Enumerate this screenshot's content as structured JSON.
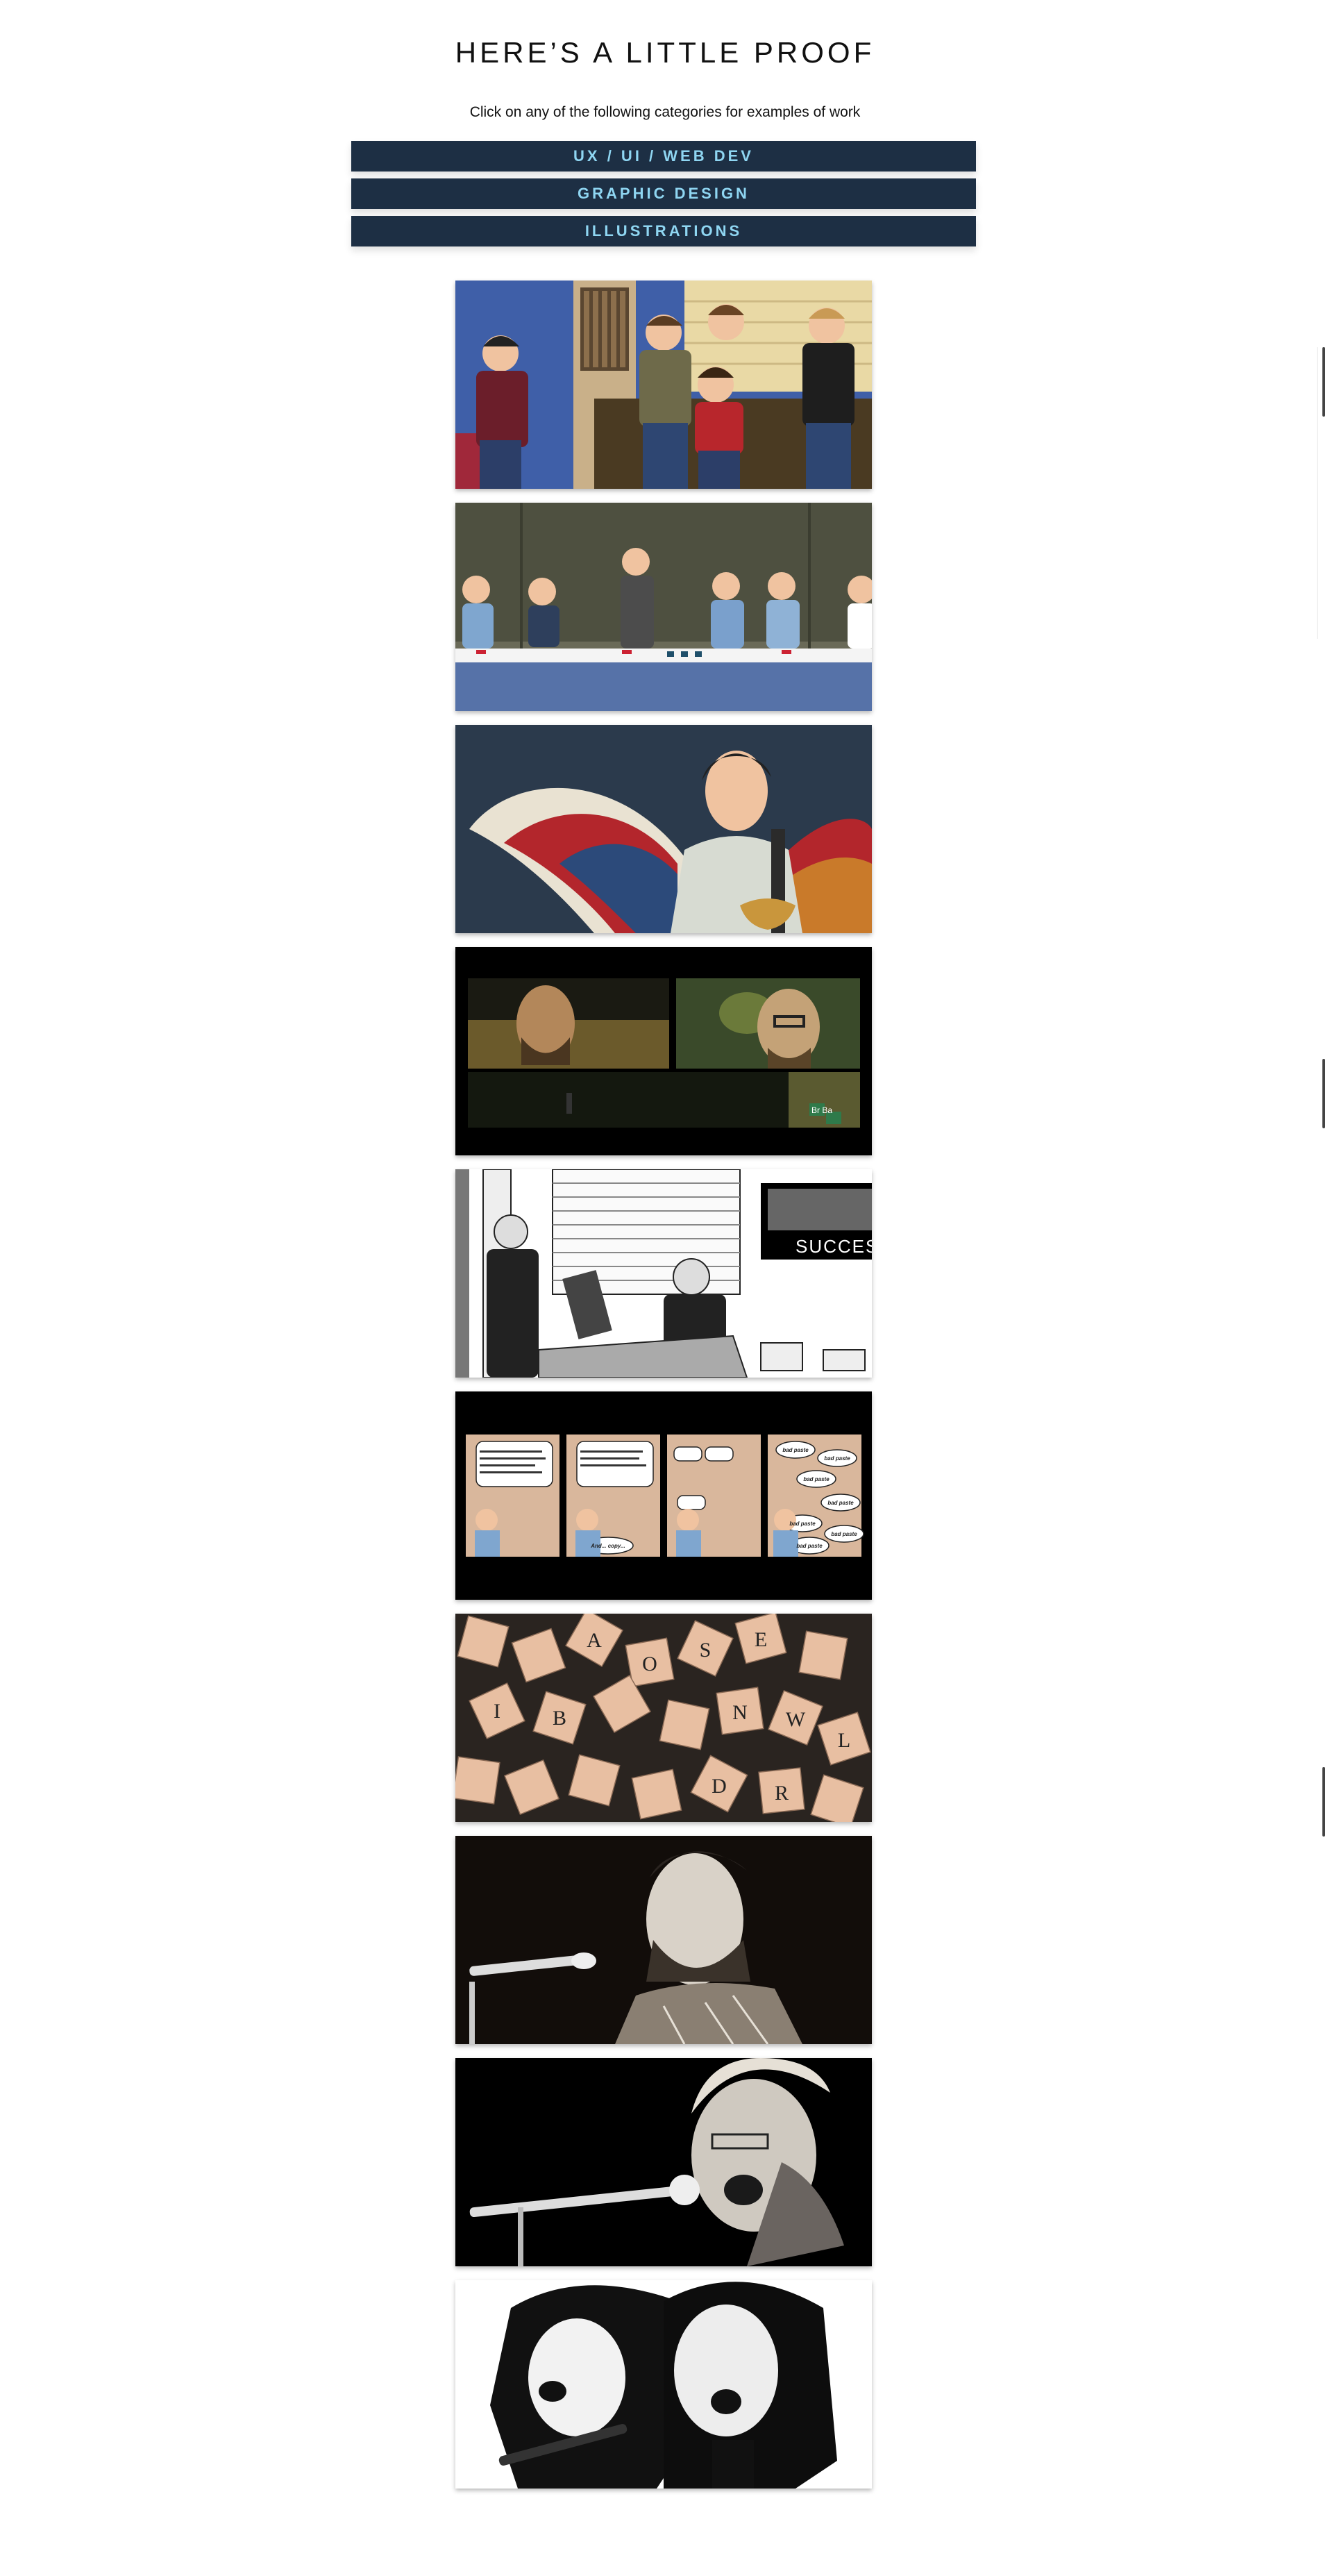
{
  "proof": {
    "heading": "HERE’S A LITTLE PROOF",
    "subheading": "Click on any of the following categories for examples of work",
    "categories": [
      {
        "label": "UX / UI / WEB DEV"
      },
      {
        "label": "GRAPHIC DESIGN"
      },
      {
        "label": "ILLUSTRATIONS"
      }
    ]
  },
  "gallery": {
    "items": [
      {
        "theme": "cartoon-friends-couch"
      },
      {
        "theme": "cartoon-last-supper-table"
      },
      {
        "theme": "musician-with-wings"
      },
      {
        "theme": "dark-comic-panels",
        "sign_text": "Br Ba"
      },
      {
        "theme": "office-handshake-comic",
        "tv_text": "SUCCES"
      },
      {
        "theme": "four-panel-office-comic",
        "speech": [
          "And... copy...",
          "bad paste",
          "bad paste",
          "bad paste",
          "bad paste",
          "bad paste",
          "bad paste",
          "bad paste"
        ]
      },
      {
        "theme": "scrabble-tiles",
        "letters": [
          "O",
          "B",
          "I",
          "N",
          "W",
          "L",
          "R",
          "D",
          "S",
          "A",
          "E"
        ]
      },
      {
        "theme": "singer-at-mic-bw"
      },
      {
        "theme": "singer-shouting-bw"
      },
      {
        "theme": "duo-singers-bw"
      }
    ]
  },
  "colors": {
    "button_bg": "#1d2f44",
    "button_text": "#8fd6f2",
    "page_bg": "#ffffff"
  }
}
